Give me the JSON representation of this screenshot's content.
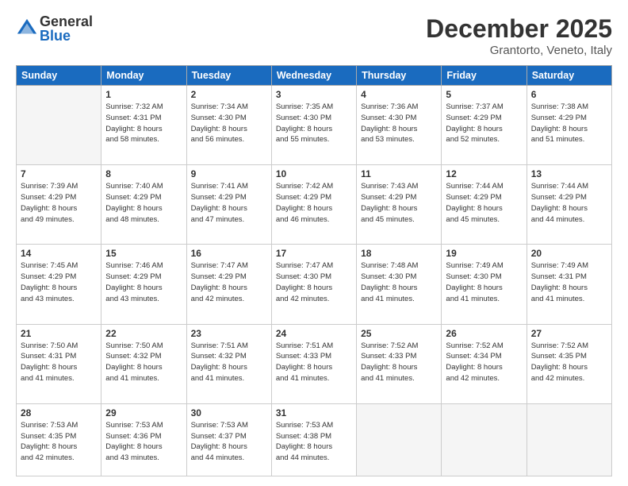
{
  "header": {
    "logo_general": "General",
    "logo_blue": "Blue",
    "month": "December 2025",
    "location": "Grantorto, Veneto, Italy"
  },
  "weekdays": [
    "Sunday",
    "Monday",
    "Tuesday",
    "Wednesday",
    "Thursday",
    "Friday",
    "Saturday"
  ],
  "weeks": [
    [
      {
        "day": "",
        "sunrise": "",
        "sunset": "",
        "daylight": "",
        "empty": true
      },
      {
        "day": "1",
        "sunrise": "Sunrise: 7:32 AM",
        "sunset": "Sunset: 4:31 PM",
        "daylight": "Daylight: 8 hours and 58 minutes."
      },
      {
        "day": "2",
        "sunrise": "Sunrise: 7:34 AM",
        "sunset": "Sunset: 4:30 PM",
        "daylight": "Daylight: 8 hours and 56 minutes."
      },
      {
        "day": "3",
        "sunrise": "Sunrise: 7:35 AM",
        "sunset": "Sunset: 4:30 PM",
        "daylight": "Daylight: 8 hours and 55 minutes."
      },
      {
        "day": "4",
        "sunrise": "Sunrise: 7:36 AM",
        "sunset": "Sunset: 4:30 PM",
        "daylight": "Daylight: 8 hours and 53 minutes."
      },
      {
        "day": "5",
        "sunrise": "Sunrise: 7:37 AM",
        "sunset": "Sunset: 4:29 PM",
        "daylight": "Daylight: 8 hours and 52 minutes."
      },
      {
        "day": "6",
        "sunrise": "Sunrise: 7:38 AM",
        "sunset": "Sunset: 4:29 PM",
        "daylight": "Daylight: 8 hours and 51 minutes."
      }
    ],
    [
      {
        "day": "7",
        "sunrise": "Sunrise: 7:39 AM",
        "sunset": "Sunset: 4:29 PM",
        "daylight": "Daylight: 8 hours and 49 minutes."
      },
      {
        "day": "8",
        "sunrise": "Sunrise: 7:40 AM",
        "sunset": "Sunset: 4:29 PM",
        "daylight": "Daylight: 8 hours and 48 minutes."
      },
      {
        "day": "9",
        "sunrise": "Sunrise: 7:41 AM",
        "sunset": "Sunset: 4:29 PM",
        "daylight": "Daylight: 8 hours and 47 minutes."
      },
      {
        "day": "10",
        "sunrise": "Sunrise: 7:42 AM",
        "sunset": "Sunset: 4:29 PM",
        "daylight": "Daylight: 8 hours and 46 minutes."
      },
      {
        "day": "11",
        "sunrise": "Sunrise: 7:43 AM",
        "sunset": "Sunset: 4:29 PM",
        "daylight": "Daylight: 8 hours and 45 minutes."
      },
      {
        "day": "12",
        "sunrise": "Sunrise: 7:44 AM",
        "sunset": "Sunset: 4:29 PM",
        "daylight": "Daylight: 8 hours and 45 minutes."
      },
      {
        "day": "13",
        "sunrise": "Sunrise: 7:44 AM",
        "sunset": "Sunset: 4:29 PM",
        "daylight": "Daylight: 8 hours and 44 minutes."
      }
    ],
    [
      {
        "day": "14",
        "sunrise": "Sunrise: 7:45 AM",
        "sunset": "Sunset: 4:29 PM",
        "daylight": "Daylight: 8 hours and 43 minutes."
      },
      {
        "day": "15",
        "sunrise": "Sunrise: 7:46 AM",
        "sunset": "Sunset: 4:29 PM",
        "daylight": "Daylight: 8 hours and 43 minutes."
      },
      {
        "day": "16",
        "sunrise": "Sunrise: 7:47 AM",
        "sunset": "Sunset: 4:29 PM",
        "daylight": "Daylight: 8 hours and 42 minutes."
      },
      {
        "day": "17",
        "sunrise": "Sunrise: 7:47 AM",
        "sunset": "Sunset: 4:30 PM",
        "daylight": "Daylight: 8 hours and 42 minutes."
      },
      {
        "day": "18",
        "sunrise": "Sunrise: 7:48 AM",
        "sunset": "Sunset: 4:30 PM",
        "daylight": "Daylight: 8 hours and 41 minutes."
      },
      {
        "day": "19",
        "sunrise": "Sunrise: 7:49 AM",
        "sunset": "Sunset: 4:30 PM",
        "daylight": "Daylight: 8 hours and 41 minutes."
      },
      {
        "day": "20",
        "sunrise": "Sunrise: 7:49 AM",
        "sunset": "Sunset: 4:31 PM",
        "daylight": "Daylight: 8 hours and 41 minutes."
      }
    ],
    [
      {
        "day": "21",
        "sunrise": "Sunrise: 7:50 AM",
        "sunset": "Sunset: 4:31 PM",
        "daylight": "Daylight: 8 hours and 41 minutes."
      },
      {
        "day": "22",
        "sunrise": "Sunrise: 7:50 AM",
        "sunset": "Sunset: 4:32 PM",
        "daylight": "Daylight: 8 hours and 41 minutes."
      },
      {
        "day": "23",
        "sunrise": "Sunrise: 7:51 AM",
        "sunset": "Sunset: 4:32 PM",
        "daylight": "Daylight: 8 hours and 41 minutes."
      },
      {
        "day": "24",
        "sunrise": "Sunrise: 7:51 AM",
        "sunset": "Sunset: 4:33 PM",
        "daylight": "Daylight: 8 hours and 41 minutes."
      },
      {
        "day": "25",
        "sunrise": "Sunrise: 7:52 AM",
        "sunset": "Sunset: 4:33 PM",
        "daylight": "Daylight: 8 hours and 41 minutes."
      },
      {
        "day": "26",
        "sunrise": "Sunrise: 7:52 AM",
        "sunset": "Sunset: 4:34 PM",
        "daylight": "Daylight: 8 hours and 42 minutes."
      },
      {
        "day": "27",
        "sunrise": "Sunrise: 7:52 AM",
        "sunset": "Sunset: 4:35 PM",
        "daylight": "Daylight: 8 hours and 42 minutes."
      }
    ],
    [
      {
        "day": "28",
        "sunrise": "Sunrise: 7:53 AM",
        "sunset": "Sunset: 4:35 PM",
        "daylight": "Daylight: 8 hours and 42 minutes."
      },
      {
        "day": "29",
        "sunrise": "Sunrise: 7:53 AM",
        "sunset": "Sunset: 4:36 PM",
        "daylight": "Daylight: 8 hours and 43 minutes."
      },
      {
        "day": "30",
        "sunrise": "Sunrise: 7:53 AM",
        "sunset": "Sunset: 4:37 PM",
        "daylight": "Daylight: 8 hours and 44 minutes."
      },
      {
        "day": "31",
        "sunrise": "Sunrise: 7:53 AM",
        "sunset": "Sunset: 4:38 PM",
        "daylight": "Daylight: 8 hours and 44 minutes."
      },
      {
        "day": "",
        "empty": true
      },
      {
        "day": "",
        "empty": true
      },
      {
        "day": "",
        "empty": true
      }
    ]
  ]
}
